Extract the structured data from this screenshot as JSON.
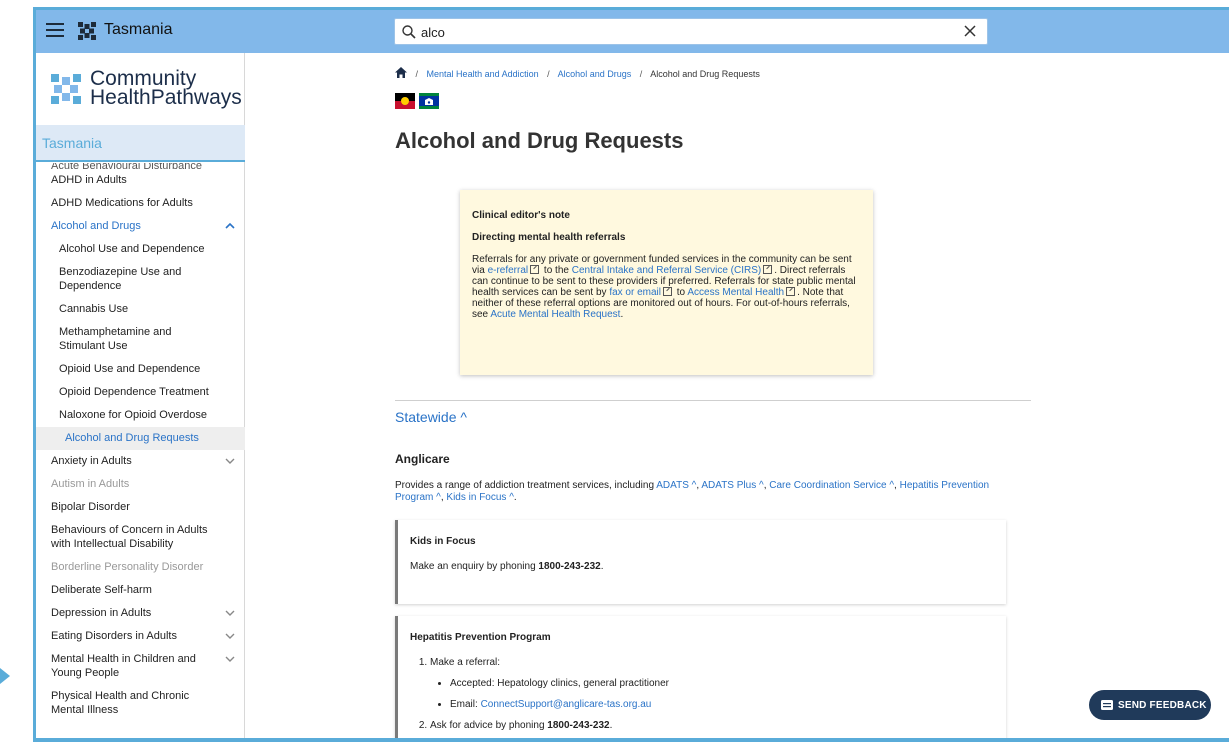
{
  "topbar": {
    "region": "Tasmania",
    "search_value": "alco"
  },
  "sidebar": {
    "logo_line1": "Community",
    "logo_line2": "HealthPathways",
    "region": "Tasmania",
    "cut_item": "Acute Behavioural Disturbance",
    "items": [
      {
        "label": "ADHD in Adults"
      },
      {
        "label": "ADHD Medications for Adults"
      },
      {
        "label": "Alcohol and Drugs"
      },
      {
        "label": "Alcohol Use and Dependence"
      },
      {
        "label": "Benzodiazepine Use and Dependence"
      },
      {
        "label": "Cannabis Use"
      },
      {
        "label": "Methamphetamine and Stimulant Use"
      },
      {
        "label": "Opioid Use and Dependence"
      },
      {
        "label": "Opioid Dependence Treatment"
      },
      {
        "label": "Naloxone for Opioid Overdose"
      },
      {
        "label": "Alcohol and Drug Requests"
      },
      {
        "label": "Anxiety in Adults"
      },
      {
        "label": "Autism in Adults"
      },
      {
        "label": "Bipolar Disorder"
      },
      {
        "label": "Behaviours of Concern in Adults with Intellectual Disability"
      },
      {
        "label": "Borderline Personality Disorder"
      },
      {
        "label": "Deliberate Self-harm"
      },
      {
        "label": "Depression in Adults"
      },
      {
        "label": "Eating Disorders in Adults"
      },
      {
        "label": "Mental Health in Children and Young People"
      },
      {
        "label": "Physical Health and Chronic Mental Illness"
      }
    ]
  },
  "breadcrumb": {
    "items": [
      "Mental Health and Addiction",
      "Alcohol and Drugs"
    ],
    "current": "Alcohol and Drug Requests"
  },
  "page": {
    "title": "Alcohol and Drug Requests"
  },
  "note": {
    "title": "Clinical editor's note",
    "subtitle": "Directing mental health referrals",
    "t1": "Referrals for any private or government funded services in the community can be sent via ",
    "l1": "e-referral",
    "t2": " to the ",
    "l2": "Central Intake and Referral Service (CIRS)",
    "t3": ". Direct referrals can continue to be sent to these providers if preferred. Referrals for state public mental health services can be sent by ",
    "l3": "fax or email",
    "t4": " to ",
    "l4": "Access Mental Health",
    "t5": ". Note that neither of these referral options are monitored out of hours. For out-of-hours referrals, see ",
    "l5": "Acute Mental Health Request",
    "t6": "."
  },
  "statewide": {
    "label": "Statewide"
  },
  "anglicare": {
    "title": "Anglicare",
    "intro": "Provides a range of addiction treatment services, including ",
    "links": [
      "ADATS",
      "ADATS Plus",
      "Care Coordination Service",
      "Hepatitis Prevention Program",
      "Kids in Focus"
    ]
  },
  "kids_in_focus": {
    "title": "Kids in Focus",
    "text": "Make an enquiry by phoning ",
    "phone": "1800-243-232",
    "end": "."
  },
  "hepatitis": {
    "title": "Hepatitis Prevention Program",
    "step1": "Make a referral:",
    "accepted": "Accepted: Hepatology clinics, general practitioner",
    "email_label": "Email: ",
    "email": "ConnectSupport@anglicare-tas.org.au",
    "step2": "Ask for advice by phoning ",
    "phone": "1800-243-232",
    "end": "."
  },
  "feedback": {
    "label": "SEND FEEDBACK"
  },
  "colors": {
    "frame": "#5aacd9",
    "topbar": "#82b8ea",
    "link": "#2a73c7",
    "note_bg": "#fff9df",
    "feedback_bg": "#203a5a"
  }
}
